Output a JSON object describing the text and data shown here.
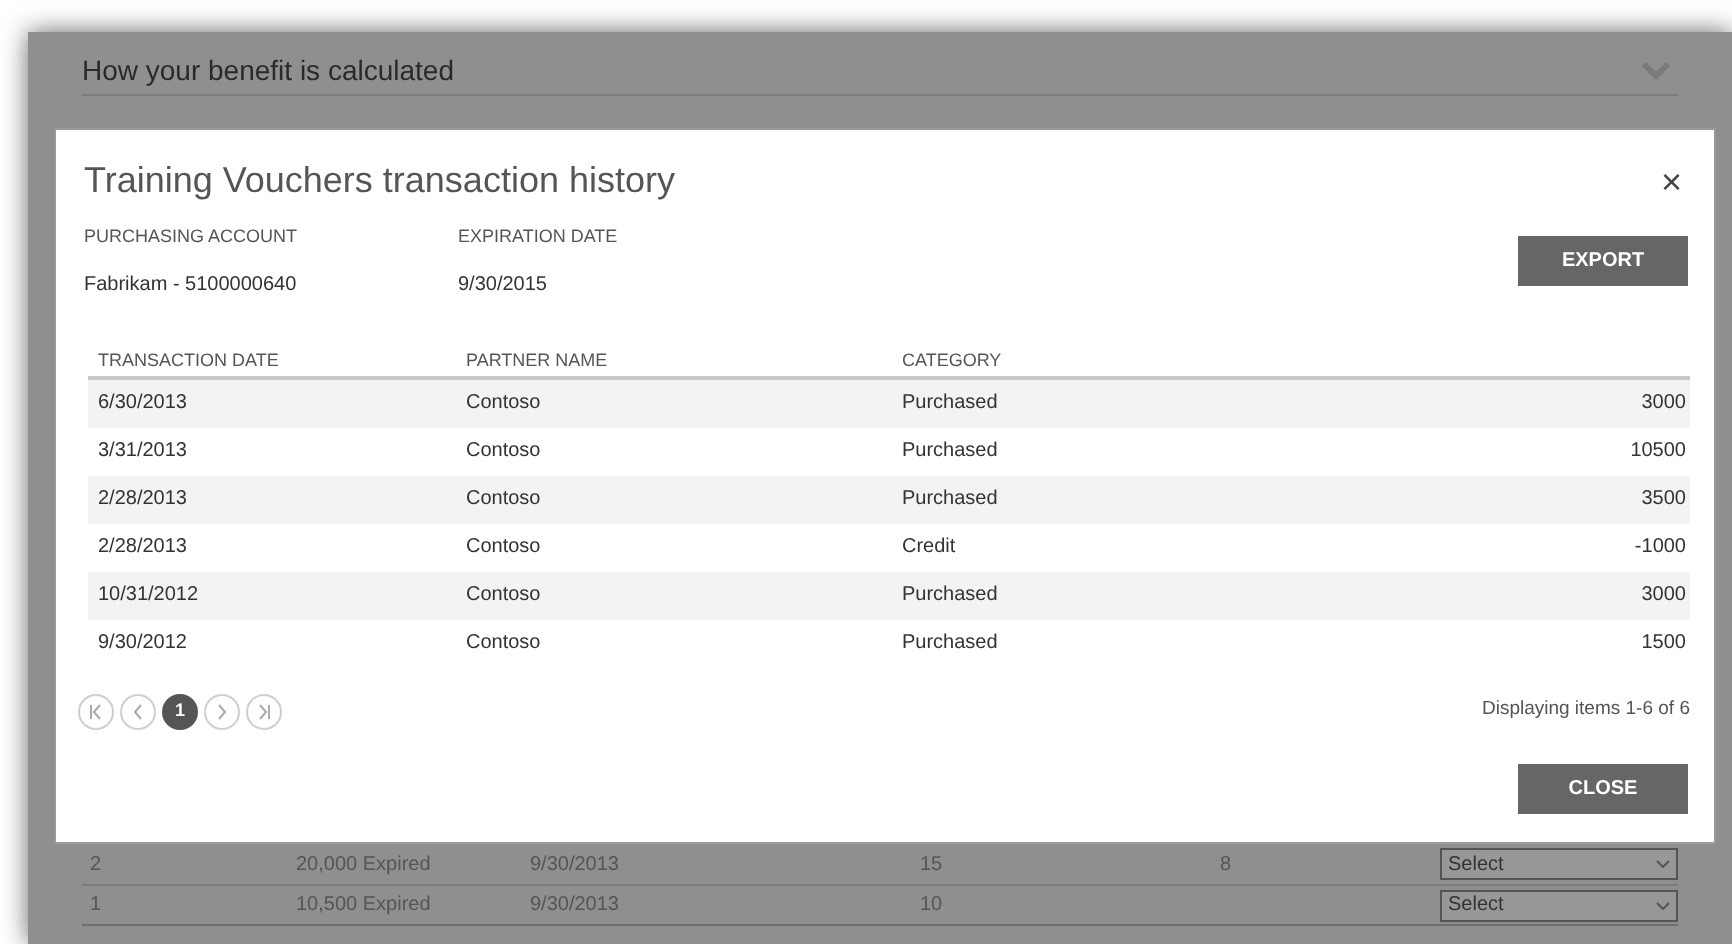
{
  "background_page": {
    "section_title": "How your benefit is calculated",
    "rows": [
      {
        "cells": [
          "2",
          "20,000 Expired",
          "9/30/2013",
          "15",
          "8"
        ],
        "dropdown": "Select"
      },
      {
        "cells": [
          "1",
          "10,500 Expired",
          "9/30/2013",
          "10",
          ""
        ],
        "dropdown": "Select"
      }
    ]
  },
  "dialog": {
    "title": "Training Vouchers transaction history",
    "close_icon": "×",
    "fields": [
      {
        "label": "PURCHASING ACCOUNT",
        "value": "Fabrikam - 5100000640"
      },
      {
        "label": "EXPIRATION DATE",
        "value": "9/30/2015"
      }
    ],
    "export_button": "EXPORT",
    "table": {
      "columns": [
        "TRANSACTION DATE",
        "PARTNER NAME",
        "CATEGORY"
      ],
      "rows": [
        [
          "6/30/2013",
          "Contoso",
          "Purchased",
          "3000"
        ],
        [
          "3/31/2013",
          "Contoso",
          "Purchased",
          "10500"
        ],
        [
          "2/28/2013",
          "Contoso",
          "Purchased",
          "3500"
        ],
        [
          "2/28/2013",
          "Contoso",
          "Credit",
          "-1000"
        ],
        [
          "10/31/2012",
          "Contoso",
          "Purchased",
          "3000"
        ],
        [
          "9/30/2012",
          "Contoso",
          "Purchased",
          "1500"
        ]
      ]
    },
    "pager": {
      "pages": [
        {
          "label": "1",
          "selected": true
        }
      ],
      "summary": "Displaying items 1-6 of 6"
    },
    "close_button": "CLOSE"
  }
}
